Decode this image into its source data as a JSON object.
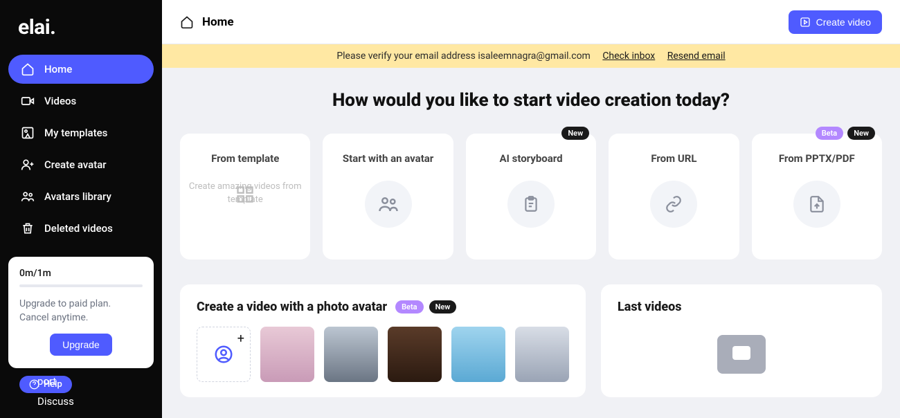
{
  "brand": "elai.",
  "topbar": {
    "title": "Home",
    "create_label": "Create video"
  },
  "verify": {
    "text": "Please verify your email address isaleemnagra@gmail.com",
    "check_inbox": "Check inbox",
    "resend": "Resend email"
  },
  "nav": {
    "home": "Home",
    "videos": "Videos",
    "templates": "My templates",
    "create_avatar": "Create avatar",
    "avatars_library": "Avatars library",
    "deleted": "Deleted videos"
  },
  "usage": {
    "value": "0m/1m",
    "desc": "Upgrade to paid plan. Cancel anytime.",
    "button": "Upgrade"
  },
  "help_label": "Help",
  "bottom": {
    "support": "port",
    "discuss": "Discuss"
  },
  "headline": "How would you like to start video creation today?",
  "cards": {
    "template": {
      "title": "From template",
      "sub": "Create amazing videos from template"
    },
    "avatar": {
      "title": "Start with an avatar"
    },
    "storyboard": {
      "title": "AI storyboard"
    },
    "url": {
      "title": "From URL"
    },
    "pptx": {
      "title": "From PPTX/PDF"
    }
  },
  "badges": {
    "new": "New",
    "beta": "Beta"
  },
  "photo_section": {
    "title": "Create a video with a photo avatar"
  },
  "last_videos": {
    "title": "Last videos"
  }
}
